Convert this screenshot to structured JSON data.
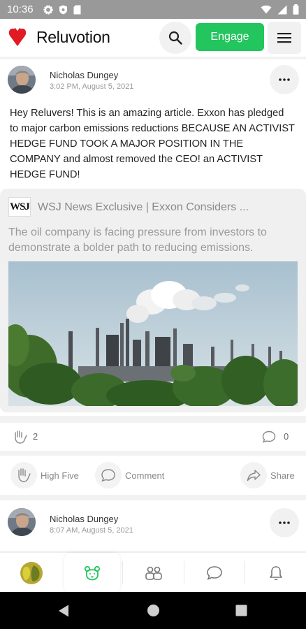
{
  "status_bar": {
    "time": "10:36",
    "left_icons": [
      "gear-icon",
      "shield-icon",
      "sd-card-icon"
    ],
    "right_icons": [
      "wifi-icon",
      "signal-icon",
      "battery-icon"
    ]
  },
  "app_bar": {
    "brand": "Reluvotion",
    "engage_label": "Engage",
    "logo_color": "#e01b24",
    "engage_color": "#22c55e"
  },
  "posts": [
    {
      "author": "Nicholas  Dungey",
      "timestamp": "3:02 PM, August 5, 2021",
      "text": "Hey Reluvers! This is an amazing article. Exxon has pledged to major carbon emissions reductions BECAUSE AN ACTIVIST HEDGE FUND TOOK A MAJOR POSITION IN THE COMPANY and almost removed the CEO!  an ACTIVIST HEDGE FUND!",
      "link": {
        "source_logo": "WSJ",
        "title": "WSJ News Exclusive | Exxon Considers ...",
        "description": "The oil company is facing pressure from investors to demonstrate a bolder path to reducing emissions."
      },
      "high_five_count": "2",
      "comment_count": "0"
    },
    {
      "author": "Nicholas  Dungey",
      "timestamp": "8:07 AM, August 5, 2021"
    }
  ],
  "actions": {
    "high_five": "High Five",
    "comment": "Comment",
    "share": "Share"
  },
  "bottom_nav": [
    "profile-avatar",
    "bear-icon",
    "group-icon",
    "chat-icon",
    "bell-icon"
  ]
}
